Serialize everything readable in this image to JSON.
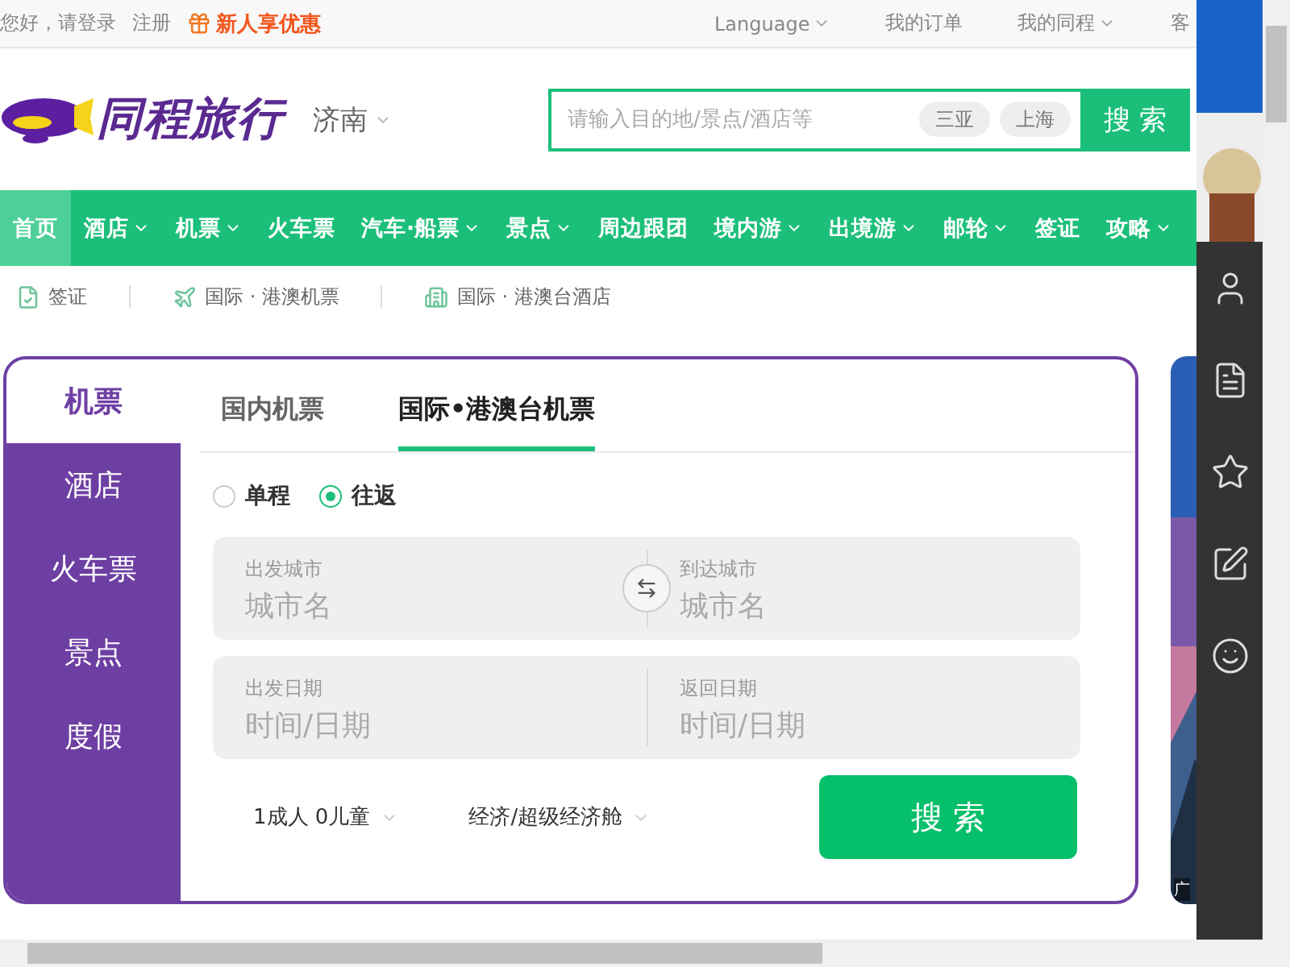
{
  "top_bar": {
    "greeting": "您好，请登录",
    "register": "注册",
    "promo": "新人享优惠",
    "links": [
      {
        "label": "Language",
        "dropdown": true
      },
      {
        "label": "我的订单",
        "dropdown": false
      },
      {
        "label": "我的同程",
        "dropdown": true
      },
      {
        "label": "客",
        "dropdown": false
      }
    ]
  },
  "header": {
    "logo": "同程旅行",
    "city": "济南",
    "search": {
      "placeholder": "请输入目的地/景点/酒店等",
      "chips": [
        "三亚",
        "上海"
      ],
      "button": "搜 索"
    }
  },
  "nav": [
    {
      "label": "首页",
      "dropdown": false,
      "selected": true
    },
    {
      "label": "酒店",
      "dropdown": true,
      "selected": false
    },
    {
      "label": "机票",
      "dropdown": true,
      "selected": false
    },
    {
      "label": "火车票",
      "dropdown": false,
      "selected": false
    },
    {
      "label": "汽车·船票",
      "dropdown": true,
      "selected": false
    },
    {
      "label": "景点",
      "dropdown": true,
      "selected": false
    },
    {
      "label": "周边跟团",
      "dropdown": false,
      "selected": false
    },
    {
      "label": "境内游",
      "dropdown": true,
      "selected": false
    },
    {
      "label": "出境游",
      "dropdown": true,
      "selected": false
    },
    {
      "label": "邮轮",
      "dropdown": true,
      "selected": false
    },
    {
      "label": "签证",
      "dropdown": false,
      "selected": false
    },
    {
      "label": "攻略",
      "dropdown": true,
      "selected": false
    }
  ],
  "sub_nav": [
    {
      "label": "签证",
      "kind": "visa"
    },
    {
      "label": "国际 · 港澳机票",
      "kind": "plane"
    },
    {
      "label": "国际 · 港澳台酒店",
      "kind": "hotel"
    }
  ],
  "booking": {
    "categories": [
      {
        "label": "机票",
        "selected": true
      },
      {
        "label": "酒店",
        "selected": false
      },
      {
        "label": "火车票",
        "selected": false
      },
      {
        "label": "景点",
        "selected": false
      },
      {
        "label": "度假",
        "selected": false
      }
    ],
    "tabs": [
      {
        "label": "国内机票",
        "selected": false
      },
      {
        "label": "国际•港澳台机票",
        "selected": true
      }
    ],
    "trip_types": [
      {
        "label": "单程",
        "selected": false
      },
      {
        "label": "往返",
        "selected": true
      }
    ],
    "rows": [
      {
        "kind": "cities",
        "fields": [
          {
            "label": "出发城市",
            "placeholder": "城市名"
          },
          {
            "label": "到达城市",
            "placeholder": "城市名"
          }
        ]
      },
      {
        "kind": "dates",
        "fields": [
          {
            "label": "出发日期",
            "placeholder": "时间/日期"
          },
          {
            "label": "返回日期",
            "placeholder": "时间/日期"
          }
        ]
      }
    ],
    "passengers": "1成人 0儿童",
    "cabin": "经济/超级经济舱",
    "button": "搜 索"
  },
  "ad": {
    "kind": "picture",
    "label": "广"
  },
  "side_tools": [
    {
      "kind": "user"
    },
    {
      "kind": "list"
    },
    {
      "kind": "star"
    },
    {
      "kind": "edit"
    },
    {
      "kind": "smile"
    }
  ]
}
